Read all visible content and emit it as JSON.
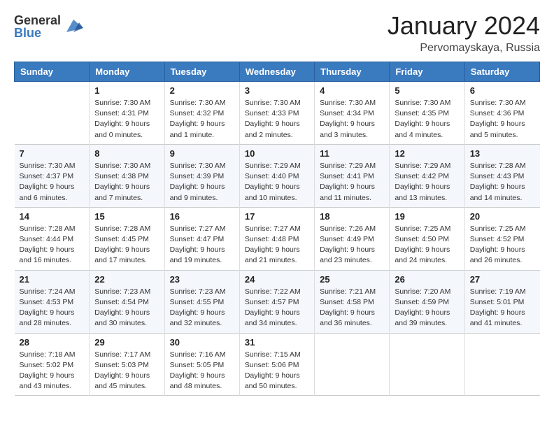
{
  "logo": {
    "general": "General",
    "blue": "Blue"
  },
  "header": {
    "month": "January 2024",
    "location": "Pervomayskaya, Russia"
  },
  "days": [
    "Sunday",
    "Monday",
    "Tuesday",
    "Wednesday",
    "Thursday",
    "Friday",
    "Saturday"
  ],
  "weeks": [
    [
      {
        "day": "",
        "sunrise": "",
        "sunset": "",
        "daylight": ""
      },
      {
        "day": "1",
        "sunrise": "Sunrise: 7:30 AM",
        "sunset": "Sunset: 4:31 PM",
        "daylight": "Daylight: 9 hours and 0 minutes."
      },
      {
        "day": "2",
        "sunrise": "Sunrise: 7:30 AM",
        "sunset": "Sunset: 4:32 PM",
        "daylight": "Daylight: 9 hours and 1 minute."
      },
      {
        "day": "3",
        "sunrise": "Sunrise: 7:30 AM",
        "sunset": "Sunset: 4:33 PM",
        "daylight": "Daylight: 9 hours and 2 minutes."
      },
      {
        "day": "4",
        "sunrise": "Sunrise: 7:30 AM",
        "sunset": "Sunset: 4:34 PM",
        "daylight": "Daylight: 9 hours and 3 minutes."
      },
      {
        "day": "5",
        "sunrise": "Sunrise: 7:30 AM",
        "sunset": "Sunset: 4:35 PM",
        "daylight": "Daylight: 9 hours and 4 minutes."
      },
      {
        "day": "6",
        "sunrise": "Sunrise: 7:30 AM",
        "sunset": "Sunset: 4:36 PM",
        "daylight": "Daylight: 9 hours and 5 minutes."
      }
    ],
    [
      {
        "day": "7",
        "sunrise": "Sunrise: 7:30 AM",
        "sunset": "Sunset: 4:37 PM",
        "daylight": "Daylight: 9 hours and 6 minutes."
      },
      {
        "day": "8",
        "sunrise": "Sunrise: 7:30 AM",
        "sunset": "Sunset: 4:38 PM",
        "daylight": "Daylight: 9 hours and 7 minutes."
      },
      {
        "day": "9",
        "sunrise": "Sunrise: 7:30 AM",
        "sunset": "Sunset: 4:39 PM",
        "daylight": "Daylight: 9 hours and 9 minutes."
      },
      {
        "day": "10",
        "sunrise": "Sunrise: 7:29 AM",
        "sunset": "Sunset: 4:40 PM",
        "daylight": "Daylight: 9 hours and 10 minutes."
      },
      {
        "day": "11",
        "sunrise": "Sunrise: 7:29 AM",
        "sunset": "Sunset: 4:41 PM",
        "daylight": "Daylight: 9 hours and 11 minutes."
      },
      {
        "day": "12",
        "sunrise": "Sunrise: 7:29 AM",
        "sunset": "Sunset: 4:42 PM",
        "daylight": "Daylight: 9 hours and 13 minutes."
      },
      {
        "day": "13",
        "sunrise": "Sunrise: 7:28 AM",
        "sunset": "Sunset: 4:43 PM",
        "daylight": "Daylight: 9 hours and 14 minutes."
      }
    ],
    [
      {
        "day": "14",
        "sunrise": "Sunrise: 7:28 AM",
        "sunset": "Sunset: 4:44 PM",
        "daylight": "Daylight: 9 hours and 16 minutes."
      },
      {
        "day": "15",
        "sunrise": "Sunrise: 7:28 AM",
        "sunset": "Sunset: 4:45 PM",
        "daylight": "Daylight: 9 hours and 17 minutes."
      },
      {
        "day": "16",
        "sunrise": "Sunrise: 7:27 AM",
        "sunset": "Sunset: 4:47 PM",
        "daylight": "Daylight: 9 hours and 19 minutes."
      },
      {
        "day": "17",
        "sunrise": "Sunrise: 7:27 AM",
        "sunset": "Sunset: 4:48 PM",
        "daylight": "Daylight: 9 hours and 21 minutes."
      },
      {
        "day": "18",
        "sunrise": "Sunrise: 7:26 AM",
        "sunset": "Sunset: 4:49 PM",
        "daylight": "Daylight: 9 hours and 23 minutes."
      },
      {
        "day": "19",
        "sunrise": "Sunrise: 7:25 AM",
        "sunset": "Sunset: 4:50 PM",
        "daylight": "Daylight: 9 hours and 24 minutes."
      },
      {
        "day": "20",
        "sunrise": "Sunrise: 7:25 AM",
        "sunset": "Sunset: 4:52 PM",
        "daylight": "Daylight: 9 hours and 26 minutes."
      }
    ],
    [
      {
        "day": "21",
        "sunrise": "Sunrise: 7:24 AM",
        "sunset": "Sunset: 4:53 PM",
        "daylight": "Daylight: 9 hours and 28 minutes."
      },
      {
        "day": "22",
        "sunrise": "Sunrise: 7:23 AM",
        "sunset": "Sunset: 4:54 PM",
        "daylight": "Daylight: 9 hours and 30 minutes."
      },
      {
        "day": "23",
        "sunrise": "Sunrise: 7:23 AM",
        "sunset": "Sunset: 4:55 PM",
        "daylight": "Daylight: 9 hours and 32 minutes."
      },
      {
        "day": "24",
        "sunrise": "Sunrise: 7:22 AM",
        "sunset": "Sunset: 4:57 PM",
        "daylight": "Daylight: 9 hours and 34 minutes."
      },
      {
        "day": "25",
        "sunrise": "Sunrise: 7:21 AM",
        "sunset": "Sunset: 4:58 PM",
        "daylight": "Daylight: 9 hours and 36 minutes."
      },
      {
        "day": "26",
        "sunrise": "Sunrise: 7:20 AM",
        "sunset": "Sunset: 4:59 PM",
        "daylight": "Daylight: 9 hours and 39 minutes."
      },
      {
        "day": "27",
        "sunrise": "Sunrise: 7:19 AM",
        "sunset": "Sunset: 5:01 PM",
        "daylight": "Daylight: 9 hours and 41 minutes."
      }
    ],
    [
      {
        "day": "28",
        "sunrise": "Sunrise: 7:18 AM",
        "sunset": "Sunset: 5:02 PM",
        "daylight": "Daylight: 9 hours and 43 minutes."
      },
      {
        "day": "29",
        "sunrise": "Sunrise: 7:17 AM",
        "sunset": "Sunset: 5:03 PM",
        "daylight": "Daylight: 9 hours and 45 minutes."
      },
      {
        "day": "30",
        "sunrise": "Sunrise: 7:16 AM",
        "sunset": "Sunset: 5:05 PM",
        "daylight": "Daylight: 9 hours and 48 minutes."
      },
      {
        "day": "31",
        "sunrise": "Sunrise: 7:15 AM",
        "sunset": "Sunset: 5:06 PM",
        "daylight": "Daylight: 9 hours and 50 minutes."
      },
      {
        "day": "",
        "sunrise": "",
        "sunset": "",
        "daylight": ""
      },
      {
        "day": "",
        "sunrise": "",
        "sunset": "",
        "daylight": ""
      },
      {
        "day": "",
        "sunrise": "",
        "sunset": "",
        "daylight": ""
      }
    ]
  ]
}
